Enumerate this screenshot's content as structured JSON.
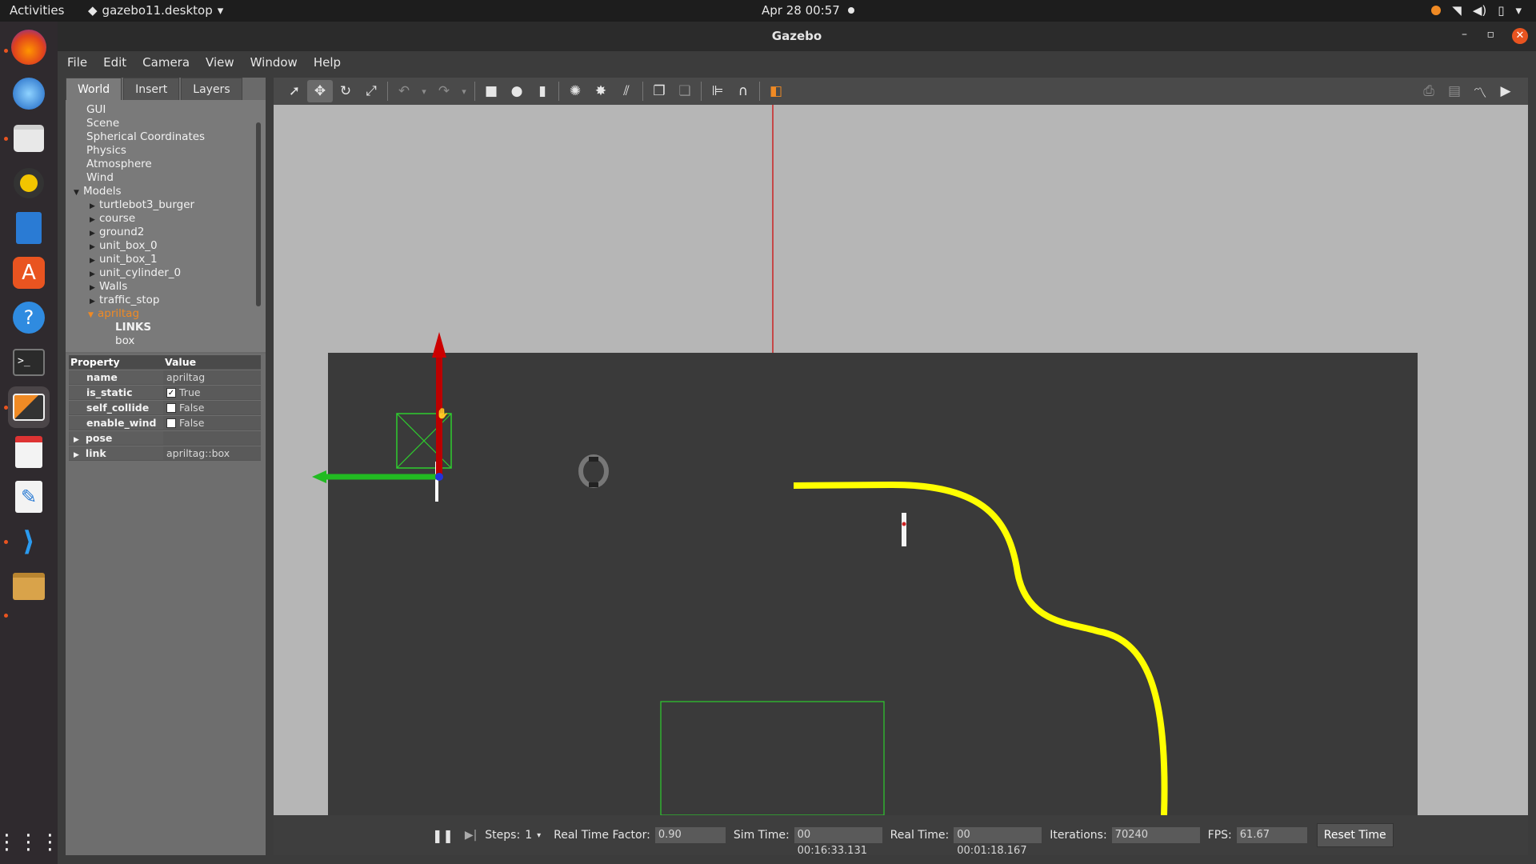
{
  "topbar": {
    "activities": "Activities",
    "app_name": "gazebo11.desktop",
    "clock": "Apr 28  00:57"
  },
  "window": {
    "title": "Gazebo",
    "minimize": "–",
    "maximize": "▫",
    "close": "✕"
  },
  "menu": [
    "File",
    "Edit",
    "Camera",
    "View",
    "Window",
    "Help"
  ],
  "left_panel": {
    "tabs": [
      "World",
      "Insert",
      "Layers"
    ],
    "tree": [
      {
        "label": "GUI",
        "indent": 0
      },
      {
        "label": "Scene",
        "indent": 0
      },
      {
        "label": "Spherical Coordinates",
        "indent": 0
      },
      {
        "label": "Physics",
        "indent": 0
      },
      {
        "label": "Atmosphere",
        "indent": 0
      },
      {
        "label": "Wind",
        "indent": 0
      },
      {
        "label": "Models",
        "indent": 0
      },
      {
        "label": "turtlebot3_burger",
        "indent": 1
      },
      {
        "label": "course",
        "indent": 1
      },
      {
        "label": "ground2",
        "indent": 1
      },
      {
        "label": "unit_box_0",
        "indent": 1
      },
      {
        "label": "unit_box_1",
        "indent": 1
      },
      {
        "label": "unit_cylinder_0",
        "indent": 1
      },
      {
        "label": "Walls",
        "indent": 1
      },
      {
        "label": "traffic_stop",
        "indent": 1
      },
      {
        "label": "apriltag",
        "indent": 1
      },
      {
        "label": "LINKS",
        "indent": 2
      },
      {
        "label": "box",
        "indent": 2
      }
    ],
    "properties": {
      "header_property": "Property",
      "header_value": "Value",
      "rows": [
        {
          "key": "name",
          "value": "apriltag",
          "checkbox": false
        },
        {
          "key": "is_static",
          "value": "True",
          "checkbox": true,
          "checked": true
        },
        {
          "key": "self_collide",
          "value": "False",
          "checkbox": true,
          "checked": false
        },
        {
          "key": "enable_wind",
          "value": "False",
          "checkbox": true,
          "checked": false
        },
        {
          "key": "pose",
          "value": "",
          "checkbox": false
        },
        {
          "key": "link",
          "value": "apriltag::box",
          "checkbox": false
        }
      ]
    }
  },
  "toolbar": {
    "tools": [
      "select-arrow-icon",
      "translate-icon",
      "rotate-icon",
      "scale-icon",
      "undo-icon",
      "undo-history-icon",
      "redo-icon",
      "redo-history-icon",
      "box-shape-icon",
      "sphere-shape-icon",
      "cylinder-shape-icon",
      "point-light-icon",
      "spot-light-icon",
      "directional-light-icon",
      "copy-icon",
      "paste-icon",
      "align-icon",
      "snap-icon",
      "view-angle-icon"
    ],
    "right_tools": [
      "screenshot-icon",
      "log-icon",
      "plot-icon",
      "record-video-icon"
    ]
  },
  "bottom": {
    "steps_label": "Steps:",
    "steps_value": "1",
    "rtf_label": "Real Time Factor:",
    "rtf_value": "0.90",
    "sim_label": "Sim Time:",
    "sim_value": "00 00:16:33.131",
    "real_label": "Real Time:",
    "real_value": "00 00:01:18.167",
    "iter_label": "Iterations:",
    "iter_value": "70240",
    "fps_label": "FPS:",
    "fps_value": "61.67",
    "reset_label": "Reset Time"
  },
  "colors": {
    "accent": "#f08a24",
    "close_button": "#e95420",
    "track_line": "#ffff00",
    "gizmo_x": "#cc0000",
    "gizmo_y": "#22bb22"
  }
}
